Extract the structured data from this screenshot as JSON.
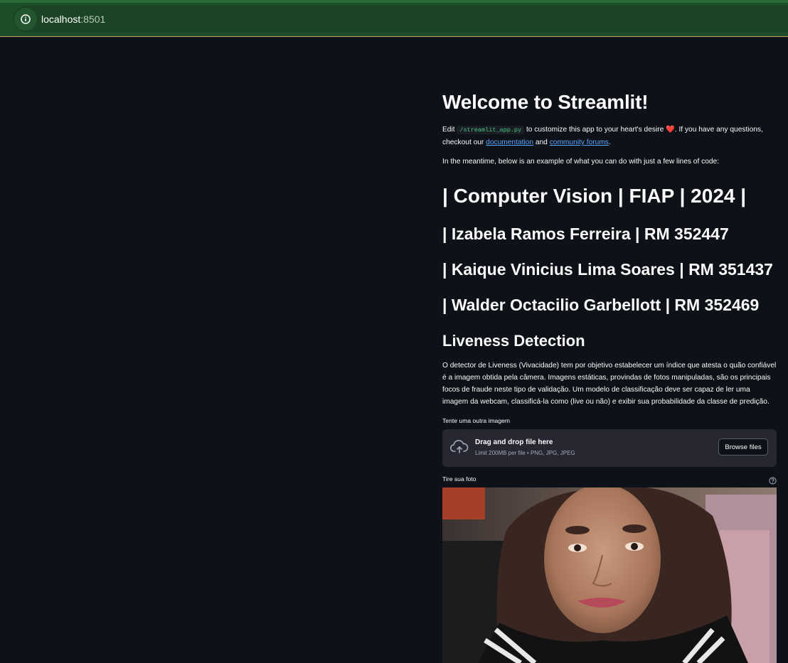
{
  "browser": {
    "url_host": "localhost",
    "url_port": ":8501"
  },
  "app": {
    "title": "Welcome to Streamlit!",
    "intro_edit": "Edit ",
    "intro_code": "/streamlit_app.py",
    "intro_middle": " to customize this app to your heart's desire ",
    "intro_heart": "❤️",
    "intro_after_heart": ". If you have any questions, checkout our ",
    "intro_link_docs": "documentation",
    "intro_and": " and ",
    "intro_link_forums": "community forums",
    "intro_end": ".",
    "meantime": "In the meantime, below is an example of what you can do with just a few lines of code:",
    "heading_main": "| Computer Vision | FIAP | 2024 |",
    "author_1": "| Izabela Ramos Ferreira | RM 352447",
    "author_2": "| Kaique Vinicius Lima Soares | RM 351437",
    "author_3": "| Walder Octacilio Garbellott | RM 352469",
    "section_title": "Liveness Detection",
    "description": "O detector de Liveness (Vivacidade) tem por objetivo estabelecer um índice que atesta o quão confiável é a imagem obtida pela câmera. Imagens estáticas, provindas de fotos manipuladas, são os principais focos de fraude neste tipo de validação. Um modelo de classificação deve ser capaz de ler uma imagem da webcam, classificá-la como (live ou não) e exibir sua probabilidade da classe de predição.",
    "uploader_label": "Tente uma outra imagem",
    "uploader_title": "Drag and drop file here",
    "uploader_subtitle": "Limit 200MB per file • PNG, JPG, JPEG",
    "browse_button": "Browse files",
    "camera_label": "Tire sua foto"
  },
  "colors": {
    "background": "#0e1117",
    "browser_bar": "#1e4d2a",
    "link": "#58a6ff",
    "code_text": "#46c883",
    "uploader_bg": "#262730"
  },
  "icons": {
    "site_info": "info-circle-icon",
    "upload": "cloud-upload-icon",
    "help": "question-circle-icon"
  }
}
